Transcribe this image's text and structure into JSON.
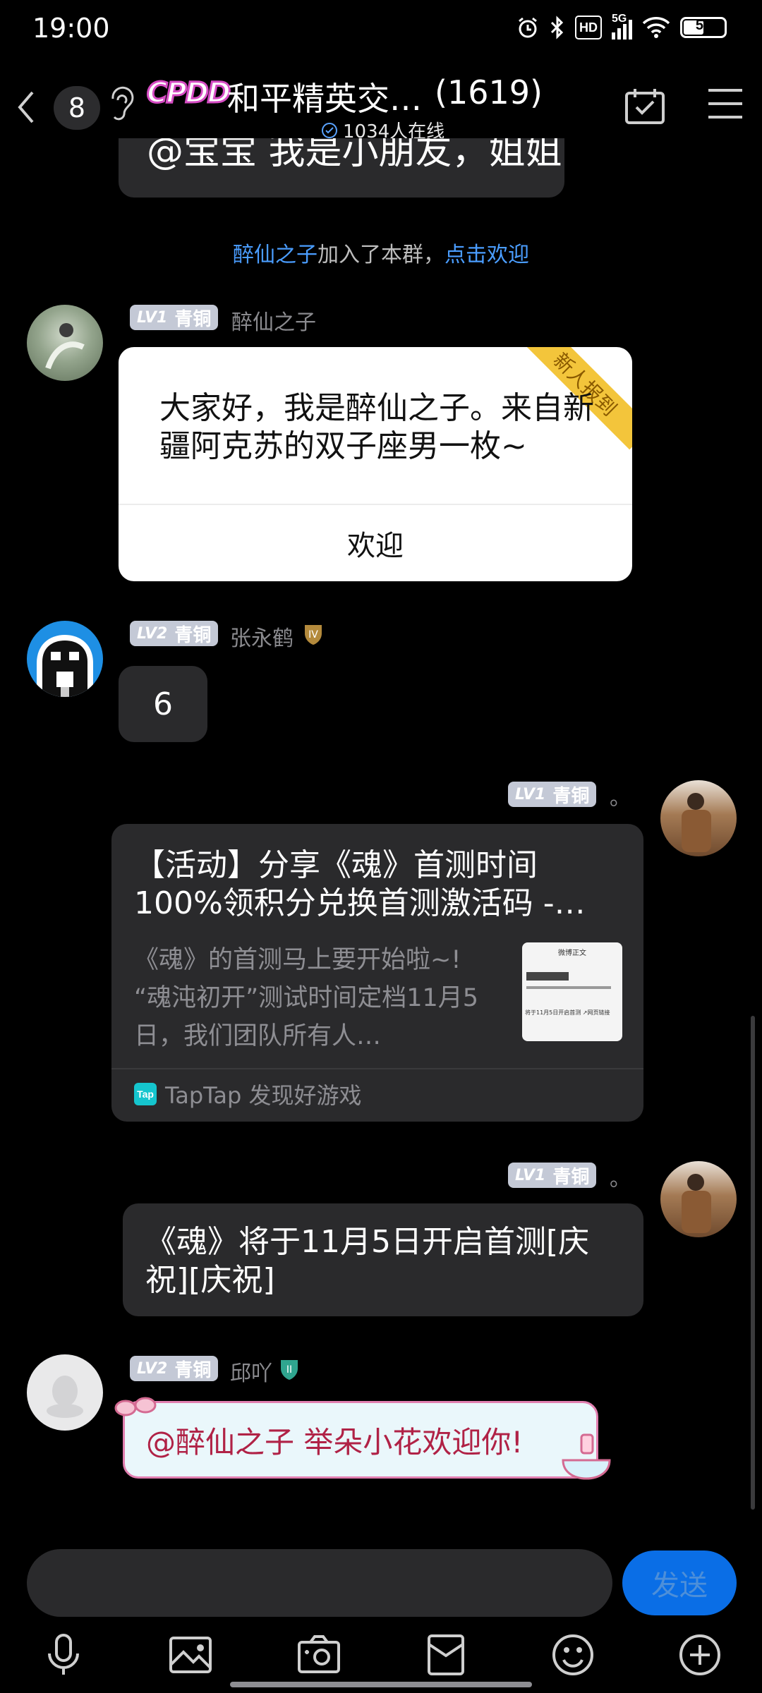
{
  "status_bar": {
    "time": "19:00",
    "network": "5G",
    "hd": "HD",
    "battery": "54",
    "battery_level": 0.54
  },
  "header": {
    "unread_count": "8",
    "group_logo_text": "CPDD",
    "group_name": "和平精英交…",
    "member_count": "(1619)",
    "online_text": "1034人在线"
  },
  "messages": {
    "partial_text": "@宝宝  我是小朋友，姐姐",
    "system": {
      "user": "醉仙之子",
      "action": "加入了本群，",
      "link": "点击欢迎"
    },
    "m1": {
      "level": "LV1",
      "rank": "青铜",
      "nick": "醉仙之子",
      "card_text": "大家好，我是醉仙之子。来自新疆阿克苏的双子座男一枚~",
      "ribbon": "新人报到",
      "button": "欢迎"
    },
    "m2": {
      "level": "LV2",
      "rank": "青铜",
      "nick": "张永鹤",
      "text": "6"
    },
    "m3": {
      "level": "LV1",
      "rank": "青铜",
      "nick": "。",
      "title": "【活动】分享《魂》首测时间100%领积分兑换首测激活码 -…",
      "desc": "《魂》的首测马上要开始啦~! “魂沌初开”测试时间定档11月5日，我们团队所有人…",
      "source_icon": "Tap",
      "source": "TapTap 发现好游戏",
      "thumb_title": "微博正文",
      "thumb_line": "将于11月5日开启首测 ↗网页链接"
    },
    "m4": {
      "level": "LV1",
      "rank": "青铜",
      "nick": "。",
      "text": "《魂》将于11月5日开启首测[庆祝][庆祝]"
    },
    "m5": {
      "level": "LV2",
      "rank": "青铜",
      "nick": "邱吖",
      "text": "@醉仙之子  举朵小花欢迎你!"
    }
  },
  "input": {
    "placeholder": "",
    "send_label": "发送"
  },
  "toolbar_icons": [
    "mic-icon",
    "image-icon",
    "camera-icon",
    "red-packet-icon",
    "emoji-icon",
    "plus-icon"
  ],
  "colors": {
    "accent": "#0a6ee6",
    "link": "#4a9dff",
    "bubble": "#2a2a2c",
    "ribbon": "#f3c53b"
  }
}
